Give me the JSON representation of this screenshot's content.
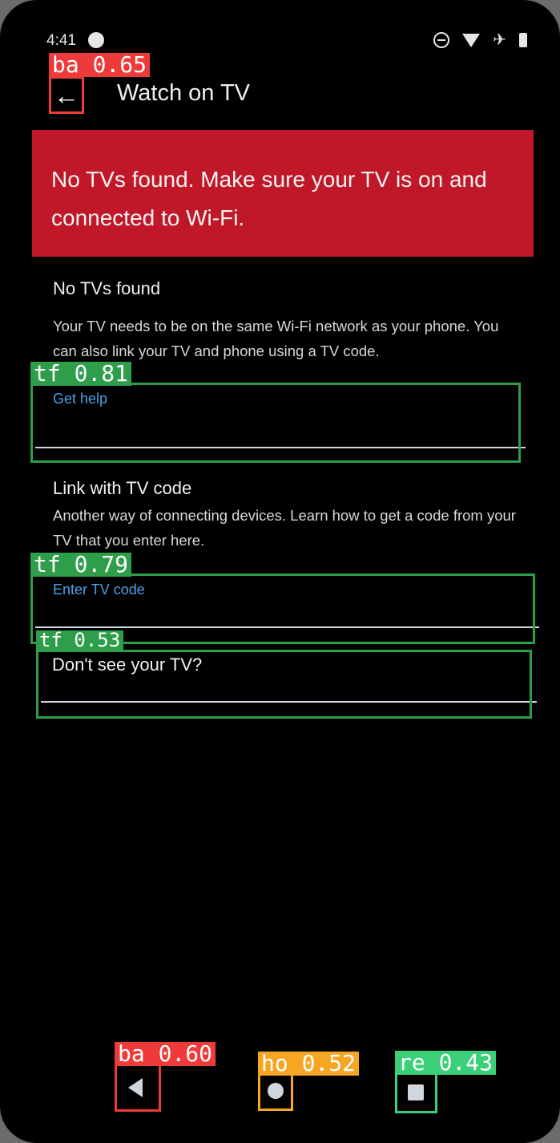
{
  "status_bar": {
    "time": "4:41",
    "icons": [
      "cast-icon",
      "dnd-icon",
      "wifi-icon",
      "airplane-icon",
      "battery-icon"
    ]
  },
  "appbar": {
    "back_icon": "arrow-left-icon",
    "title": "Watch on TV"
  },
  "banner": {
    "text": "No TVs found. Make sure your TV is on and connected to Wi-Fi.",
    "color": "#c01828"
  },
  "section1": {
    "heading": "No TVs found",
    "body": "Your TV needs to be on the same Wi-Fi network as your phone. You can also link your TV and phone using a TV code."
  },
  "field_get_help": {
    "label": "Get help"
  },
  "section2": {
    "heading": "Link with TV code",
    "body": "Another way of connecting devices. Learn how to get a code from your TV that you enter here."
  },
  "field_tv_code": {
    "label": "Enter TV code"
  },
  "field_dont_see": {
    "label": "Don't see your TV?"
  },
  "nav": {
    "back_icon": "triangle-back-icon",
    "home_icon": "circle-home-icon",
    "recents_icon": "square-recents-icon"
  },
  "detections": {
    "appbar_back": "ba 0.65",
    "get_help": "tf 0.81",
    "tv_code": "tf 0.79",
    "dont_see": "tf 0.53",
    "nav_back": "ba 0.60",
    "nav_home": "ho 0.52",
    "nav_recent": "re 0.43"
  },
  "colors": {
    "accent": "#4aa0e8",
    "detection_red": "#ef3a3a",
    "detection_green": "#2f9e4b",
    "detection_orange": "#f6a623",
    "detection_teal": "#3ccf7a"
  }
}
